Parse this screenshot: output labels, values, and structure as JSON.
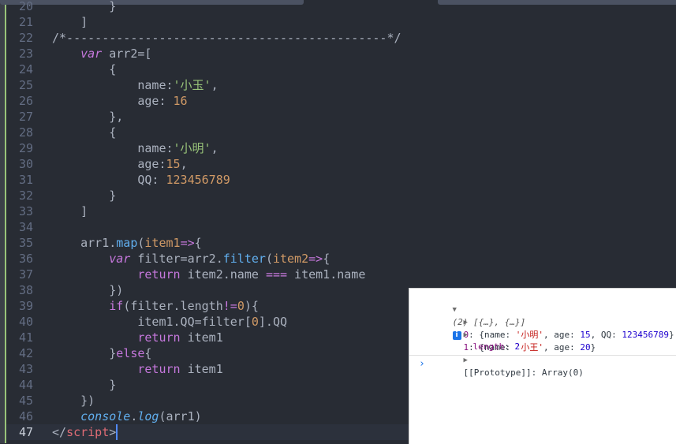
{
  "editor": {
    "lines": [
      {
        "n": "20",
        "tokens": [
          {
            "t": "        }",
            "c": ""
          }
        ]
      },
      {
        "n": "21",
        "tokens": [
          {
            "t": "    ]",
            "c": ""
          }
        ]
      },
      {
        "n": "22",
        "tokens": [
          {
            "t": "/*---------------------------------------------*/",
            "c": "comment"
          }
        ]
      },
      {
        "n": "23",
        "tokens": [
          {
            "t": "    ",
            "c": ""
          },
          {
            "t": "var",
            "c": "kw italic"
          },
          {
            "t": " arr2=[",
            "c": ""
          }
        ]
      },
      {
        "n": "24",
        "tokens": [
          {
            "t": "        {",
            "c": ""
          }
        ]
      },
      {
        "n": "25",
        "tokens": [
          {
            "t": "            name:",
            "c": ""
          },
          {
            "t": "'小玉'",
            "c": "str"
          },
          {
            "t": ",",
            "c": ""
          }
        ]
      },
      {
        "n": "26",
        "tokens": [
          {
            "t": "            age: ",
            "c": ""
          },
          {
            "t": "16",
            "c": "num"
          }
        ]
      },
      {
        "n": "27",
        "tokens": [
          {
            "t": "        },",
            "c": ""
          }
        ]
      },
      {
        "n": "28",
        "tokens": [
          {
            "t": "        {",
            "c": ""
          }
        ]
      },
      {
        "n": "29",
        "tokens": [
          {
            "t": "            name:",
            "c": ""
          },
          {
            "t": "'小明'",
            "c": "str"
          },
          {
            "t": ",",
            "c": ""
          }
        ]
      },
      {
        "n": "30",
        "tokens": [
          {
            "t": "            age:",
            "c": ""
          },
          {
            "t": "15",
            "c": "num"
          },
          {
            "t": ",",
            "c": ""
          }
        ]
      },
      {
        "n": "31",
        "tokens": [
          {
            "t": "            QQ: ",
            "c": ""
          },
          {
            "t": "123456789",
            "c": "num"
          }
        ]
      },
      {
        "n": "32",
        "tokens": [
          {
            "t": "        }",
            "c": ""
          }
        ]
      },
      {
        "n": "33",
        "tokens": [
          {
            "t": "    ]",
            "c": ""
          }
        ]
      },
      {
        "n": "34",
        "tokens": []
      },
      {
        "n": "35",
        "tokens": [
          {
            "t": "    arr1.",
            "c": ""
          },
          {
            "t": "map",
            "c": "fn"
          },
          {
            "t": "(",
            "c": ""
          },
          {
            "t": "item1",
            "c": "num"
          },
          {
            "t": "=>",
            "c": "kw"
          },
          {
            "t": "{",
            "c": ""
          }
        ]
      },
      {
        "n": "36",
        "tokens": [
          {
            "t": "        ",
            "c": ""
          },
          {
            "t": "var",
            "c": "kw italic"
          },
          {
            "t": " filter=arr2.",
            "c": ""
          },
          {
            "t": "filter",
            "c": "fn"
          },
          {
            "t": "(",
            "c": ""
          },
          {
            "t": "item2",
            "c": "num"
          },
          {
            "t": "=>",
            "c": "kw"
          },
          {
            "t": "{",
            "c": ""
          }
        ]
      },
      {
        "n": "37",
        "tokens": [
          {
            "t": "            ",
            "c": ""
          },
          {
            "t": "return",
            "c": "kw"
          },
          {
            "t": " item2.name ",
            "c": ""
          },
          {
            "t": "===",
            "c": "kw"
          },
          {
            "t": " item1.name",
            "c": ""
          }
        ]
      },
      {
        "n": "38",
        "tokens": [
          {
            "t": "        })",
            "c": ""
          }
        ]
      },
      {
        "n": "39",
        "tokens": [
          {
            "t": "        ",
            "c": ""
          },
          {
            "t": "if",
            "c": "kw"
          },
          {
            "t": "(filter.length",
            "c": ""
          },
          {
            "t": "!=",
            "c": "kw"
          },
          {
            "t": "0",
            "c": "num"
          },
          {
            "t": "){",
            "c": ""
          }
        ]
      },
      {
        "n": "40",
        "tokens": [
          {
            "t": "            item1.QQ=filter[",
            "c": ""
          },
          {
            "t": "0",
            "c": "num"
          },
          {
            "t": "].QQ",
            "c": ""
          }
        ]
      },
      {
        "n": "41",
        "tokens": [
          {
            "t": "            ",
            "c": ""
          },
          {
            "t": "return",
            "c": "kw"
          },
          {
            "t": " item1",
            "c": ""
          }
        ]
      },
      {
        "n": "42",
        "tokens": [
          {
            "t": "        }",
            "c": ""
          },
          {
            "t": "else",
            "c": "kw"
          },
          {
            "t": "{",
            "c": ""
          }
        ]
      },
      {
        "n": "43",
        "tokens": [
          {
            "t": "            ",
            "c": ""
          },
          {
            "t": "return",
            "c": "kw"
          },
          {
            "t": " item1",
            "c": ""
          }
        ]
      },
      {
        "n": "44",
        "tokens": [
          {
            "t": "        }",
            "c": ""
          }
        ]
      },
      {
        "n": "45",
        "tokens": [
          {
            "t": "    })",
            "c": ""
          }
        ]
      },
      {
        "n": "46",
        "tokens": [
          {
            "t": "    ",
            "c": ""
          },
          {
            "t": "console",
            "c": "fn italic"
          },
          {
            "t": ".",
            "c": ""
          },
          {
            "t": "log",
            "c": "fn italic"
          },
          {
            "t": "(arr1)",
            "c": ""
          }
        ]
      },
      {
        "n": "47",
        "tokens": [
          {
            "t": "</",
            "c": "comment"
          },
          {
            "t": "script",
            "c": "tag"
          },
          {
            "t": ">",
            "c": "comment"
          }
        ],
        "active": true
      }
    ]
  },
  "console": {
    "summary_expand_icon": "triangle-down-icon",
    "summary": "(2) [{…}, {…}]",
    "info_icon_label": "i",
    "items": [
      {
        "index": "0",
        "name": "'小明'",
        "age": "15",
        "qq": "123456789"
      },
      {
        "index": "1",
        "name": "'小王'",
        "age": "20"
      }
    ],
    "length_label": "length",
    "length_value": "2",
    "prototype_label": "[[Prototype]]",
    "prototype_value": "Array(0)",
    "prompt": "›"
  }
}
